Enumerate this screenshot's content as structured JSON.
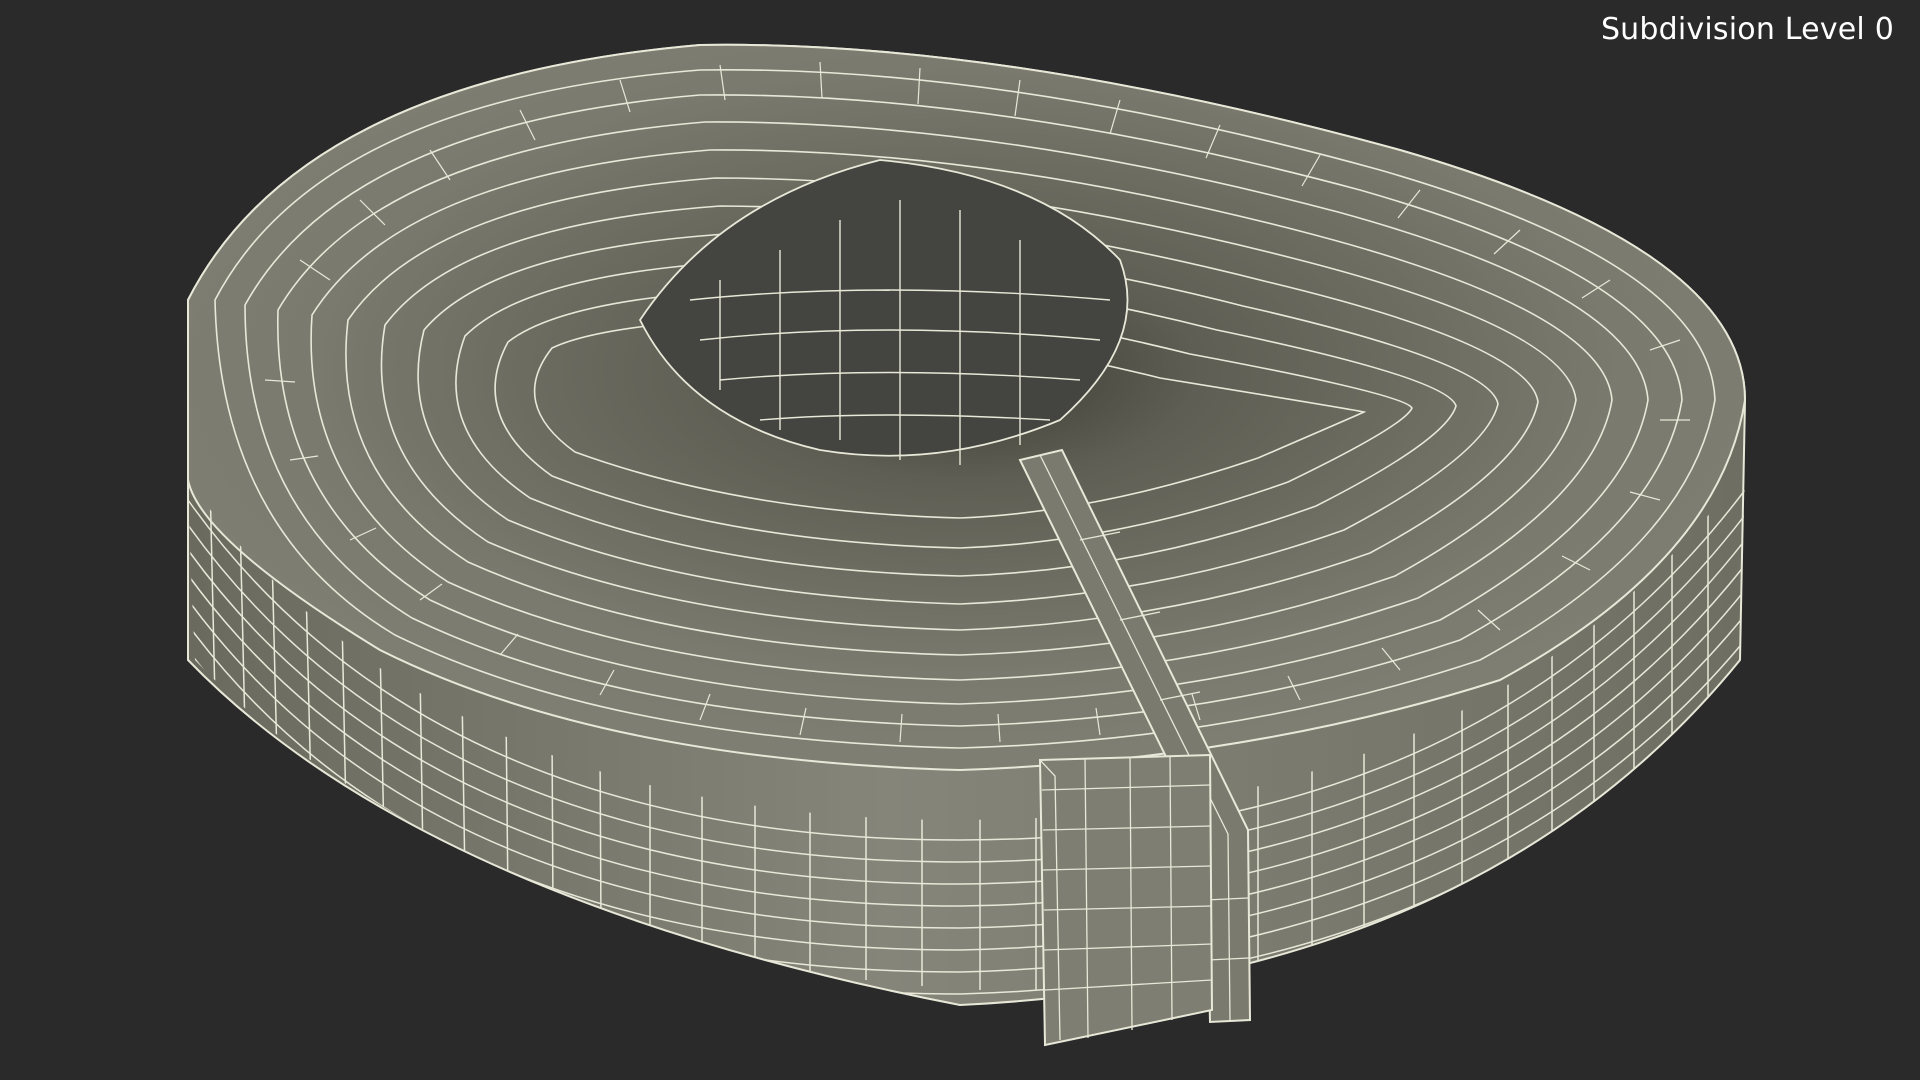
{
  "viewport": {
    "overlay_label": "Subdivision Level 0",
    "background_color": "#2a2a2a"
  },
  "model": {
    "subject": "rolled-flat-hose-wireframe",
    "surface_color": "#7c7c6e",
    "wire_color": "#e8e8d8",
    "shadow_color": "#4a4a42"
  }
}
